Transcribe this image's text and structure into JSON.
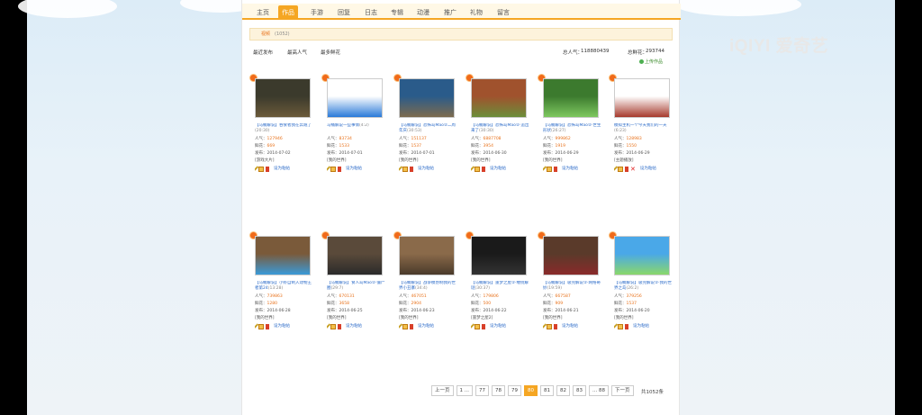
{
  "watermark": "iQIYI 爱奇艺",
  "nav": {
    "tabs": [
      "主页",
      "作品",
      "手游",
      "回复",
      "日志",
      "专辑",
      "动漫",
      "推广",
      "礼物",
      "留言"
    ],
    "active_index": 1
  },
  "subbar": {
    "label": "视频",
    "count": "(1052)",
    "upload_button": "上传作品"
  },
  "sort": {
    "options": [
      "最近发布",
      "最高人气",
      "最多鲜花"
    ],
    "popularity_label": "总人气：",
    "popularity_value": "118880439",
    "flowers_label": "总鲜花：",
    "flowers_value": "293744"
  },
  "videos": [
    {
      "title": "【马桶解说】吞食者我在奔跑了",
      "dur": "(20:30)",
      "pop": "127946",
      "flower": "669",
      "date": "2014-07-02",
      "tag": "[游戏大片]",
      "action": "设为粘帖"
    },
    {
      "title": "马桶解说一些事情",
      "dur": "(4:2)",
      "pop": "83734",
      "flower": "1533",
      "date": "2014-07-01",
      "tag": "[我的世界]",
      "action": "设为粘帖"
    },
    {
      "title": "【马桶解说】恐怖岛Mao②二周年庆",
      "dur": "(30:53)",
      "pop": "151137",
      "flower": "1537",
      "date": "2014-07-01",
      "tag": "[我的世界]",
      "action": "设为粘帖"
    },
    {
      "title": "【马桶解说】恐怖岛Mao②·追出来了",
      "dur": "(30:30)",
      "pop": "6887708",
      "flower": "3954",
      "date": "2014-06-30",
      "tag": "[我的世界]",
      "action": "设为粘帖"
    },
    {
      "title": "【马桶解说】恐怖岛Mao②·世生形状",
      "dur": "(26:27)",
      "pop": "999862",
      "flower": "1919",
      "date": "2014-06-29",
      "tag": "[我的世界]",
      "action": "设为粘帖"
    },
    {
      "title": "模拟主机一个今天我们的一天",
      "dur": "(6:23)",
      "pop": "128983",
      "flower": "1550",
      "date": "2014-06-29",
      "tag": "[主题播放]",
      "action": "设为粘帖"
    },
    {
      "title": "【马桶解说】小虾自制入动物王者第24",
      "dur": "(13:28)",
      "pop": "739863",
      "flower": "1280",
      "date": "2014-06-28",
      "tag": "[我的世界]",
      "action": "设为粘帖"
    },
    {
      "title": "【马桶解说】食人岛Mao②·僵尸圈",
      "dur": "(29:7)",
      "pop": "670131",
      "flower": "3658",
      "date": "2014-06-25",
      "tag": "[我的世界]",
      "action": "设为粘帖"
    },
    {
      "title": "【马桶解说】战争模仿制我的世界小丑寨",
      "dur": "(34:4)",
      "pop": "467051",
      "flower": "2904",
      "date": "2014-06-23",
      "tag": "[我的世界]",
      "action": "设为粘帖"
    },
    {
      "title": "【马桶解说】噩梦之屋②·缠绕解谜",
      "dur": "(30:37)",
      "pop": "179806",
      "flower": "500",
      "date": "2014-06-22",
      "tag": "[噩梦之屋2]",
      "action": "设为粘帖"
    },
    {
      "title": "【马桶解说】吸完解说②·网络奇妙",
      "dur": "(19:59)",
      "pop": "667587",
      "flower": "909",
      "date": "2014-06-21",
      "tag": "[我的世界]",
      "action": "设为粘帖"
    },
    {
      "title": "【马桶解说】吸完解说②·我的世界之岛",
      "dur": "(26:2)",
      "pop": "379256",
      "flower": "1537",
      "date": "2014-06-20",
      "tag": "[我的世界]",
      "action": "设为粘帖"
    }
  ],
  "labels": {
    "pop": "人气：",
    "flower": "鲜花：",
    "date": "发布："
  },
  "pager": {
    "prev": "上一页",
    "pages": [
      "1 ...",
      "77",
      "78",
      "79",
      "80",
      "81",
      "82",
      "83",
      "... 88"
    ],
    "current": "80",
    "next": "下一页",
    "total": "共1052条"
  }
}
